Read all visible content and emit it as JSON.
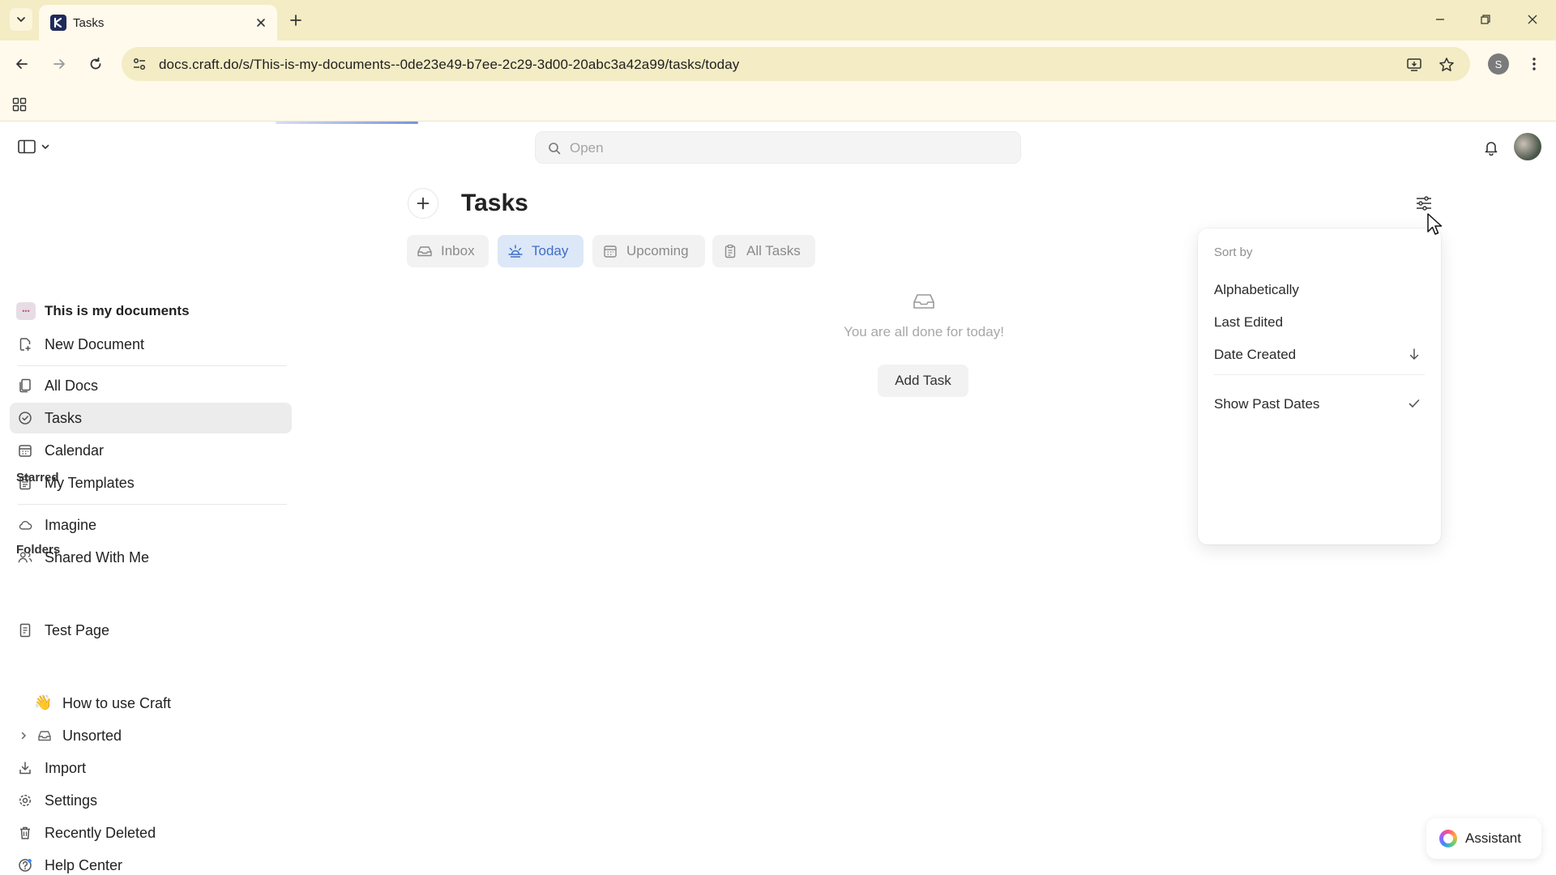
{
  "browser": {
    "tab_title": "Tasks",
    "url": "docs.craft.do/s/This-is-my-documents--0de23e49-b7ee-2c29-3d00-20abc3a42a99/tasks/today",
    "profile_initial": "S"
  },
  "sidebar": {
    "workspace": "This is my documents",
    "workspace_badge": "•••",
    "items": [
      {
        "label": "New Document"
      },
      {
        "label": "All Docs"
      },
      {
        "label": "Tasks"
      },
      {
        "label": "Calendar"
      },
      {
        "label": "My Templates"
      },
      {
        "label": "Imagine"
      },
      {
        "label": "Shared With Me"
      }
    ],
    "starred_heading": "Starred",
    "starred": [
      {
        "label": "Test Page"
      }
    ],
    "folders_heading": "Folders",
    "folders": [
      {
        "label": "How to use Craft",
        "emoji": "👋"
      },
      {
        "label": "Unsorted"
      }
    ],
    "bottom": [
      {
        "label": "Import"
      },
      {
        "label": "Settings"
      },
      {
        "label": "Recently Deleted"
      },
      {
        "label": "Help Center"
      }
    ]
  },
  "header": {
    "search_placeholder": "Open"
  },
  "main": {
    "title": "Tasks",
    "tabs": [
      {
        "label": "Inbox"
      },
      {
        "label": "Today"
      },
      {
        "label": "Upcoming"
      },
      {
        "label": "All Tasks"
      }
    ],
    "active_tab": "Today",
    "empty_text": "You are all done for today!",
    "add_task_label": "Add Task"
  },
  "sort_menu": {
    "heading": "Sort by",
    "options": [
      {
        "label": "Alphabetically"
      },
      {
        "label": "Last Edited"
      },
      {
        "label": "Date Created"
      }
    ],
    "show_past_dates_label": "Show Past Dates"
  },
  "assistant": {
    "label": "Assistant"
  },
  "colors": {
    "chrome_tabstrip": "#f3ecc4",
    "chrome_toolbar": "#fffaec",
    "active_tab_bg": "#dce7f8",
    "active_tab_text": "#3f6fc4"
  }
}
